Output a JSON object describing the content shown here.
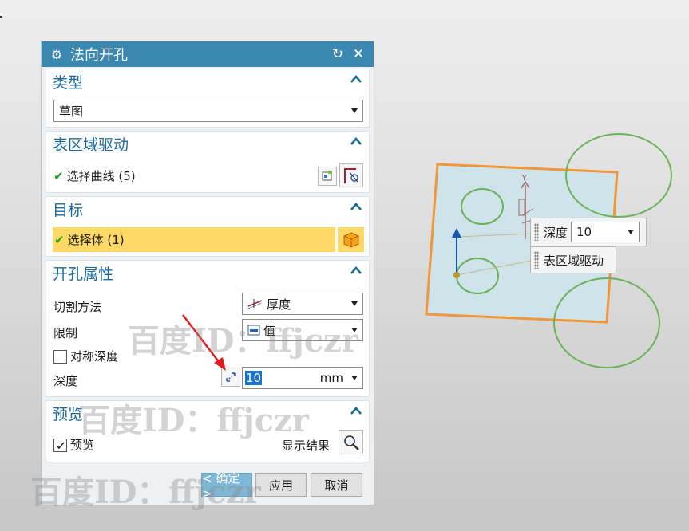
{
  "dialog": {
    "title": "法向开孔",
    "type_section": {
      "header": "类型",
      "selected": "草图"
    },
    "region_section": {
      "header": "表区域驱动",
      "select_curve": "选择曲线 (5)"
    },
    "target_section": {
      "header": "目标",
      "select_body": "选择体 (1)"
    },
    "hole_section": {
      "header": "开孔属性",
      "cut_method_label": "切割方法",
      "cut_method_value": "厚度",
      "limit_label": "限制",
      "limit_value": "值",
      "symmetric_label": "对称深度",
      "depth_label": "深度",
      "depth_value": "10",
      "depth_unit": "mm"
    },
    "preview_section": {
      "header": "预览",
      "preview_label": "预览",
      "show_result_label": "显示结果"
    },
    "buttons": {
      "ok": "< 确定 >",
      "apply": "应用",
      "cancel": "取消"
    }
  },
  "watermark": "百度ID：ffjczr",
  "viewport": {
    "depth_label": "深度",
    "depth_value": "10",
    "region_label": "表区域驱动",
    "axis_label": "Y"
  },
  "colors": {
    "titlebar": "#3a87b0",
    "section_header": "#1d6b9a",
    "highlight_row": "#ffd966",
    "sheet_fill": "#cfe3ea",
    "sheet_border": "#f0973a",
    "circle": "#6ab358",
    "ok_button": "#7fb8d6"
  }
}
